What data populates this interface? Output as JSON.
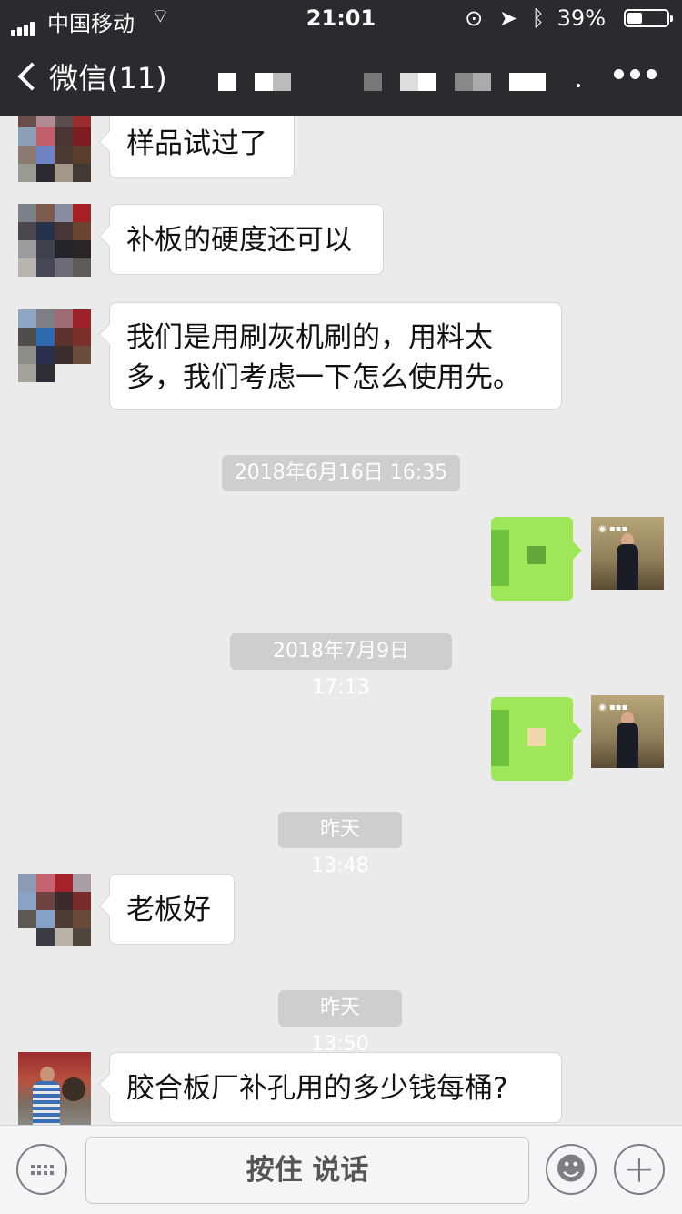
{
  "status": {
    "carrier": "中国移动",
    "time": "21:01",
    "battery": "39%",
    "battery_level": 0.39
  },
  "nav": {
    "back_label": "微信(11)"
  },
  "messages": [
    {
      "type": "text",
      "from": "other",
      "text": "样品试过了"
    },
    {
      "type": "text",
      "from": "other",
      "text": "补板的硬度还可以"
    },
    {
      "type": "text",
      "from": "other",
      "text": "我们是用刷灰机刷的，用料太多，我们考虑一下怎么使用先。"
    },
    {
      "type": "timestamp",
      "text": "2018年6月16日 16:35"
    },
    {
      "type": "image",
      "from": "me"
    },
    {
      "type": "timestamp",
      "text": "2018年7月9日 17:13"
    },
    {
      "type": "image",
      "from": "me"
    },
    {
      "type": "timestamp",
      "text": "昨天 13:48"
    },
    {
      "type": "text",
      "from": "other",
      "text": "老板好"
    },
    {
      "type": "timestamp",
      "text": "昨天 13:50"
    },
    {
      "type": "text",
      "from": "other",
      "text": "胶合板厂补孔用的多少钱每桶?"
    }
  ],
  "input": {
    "hold_to_talk": "按住 说话"
  },
  "icons": [
    "signal-icon",
    "wifi-icon",
    "lock-icon",
    "location-icon",
    "bluetooth-icon",
    "battery-icon",
    "back-chevron-icon",
    "more-icon",
    "keyboard-icon",
    "emoji-icon",
    "plus-icon"
  ]
}
